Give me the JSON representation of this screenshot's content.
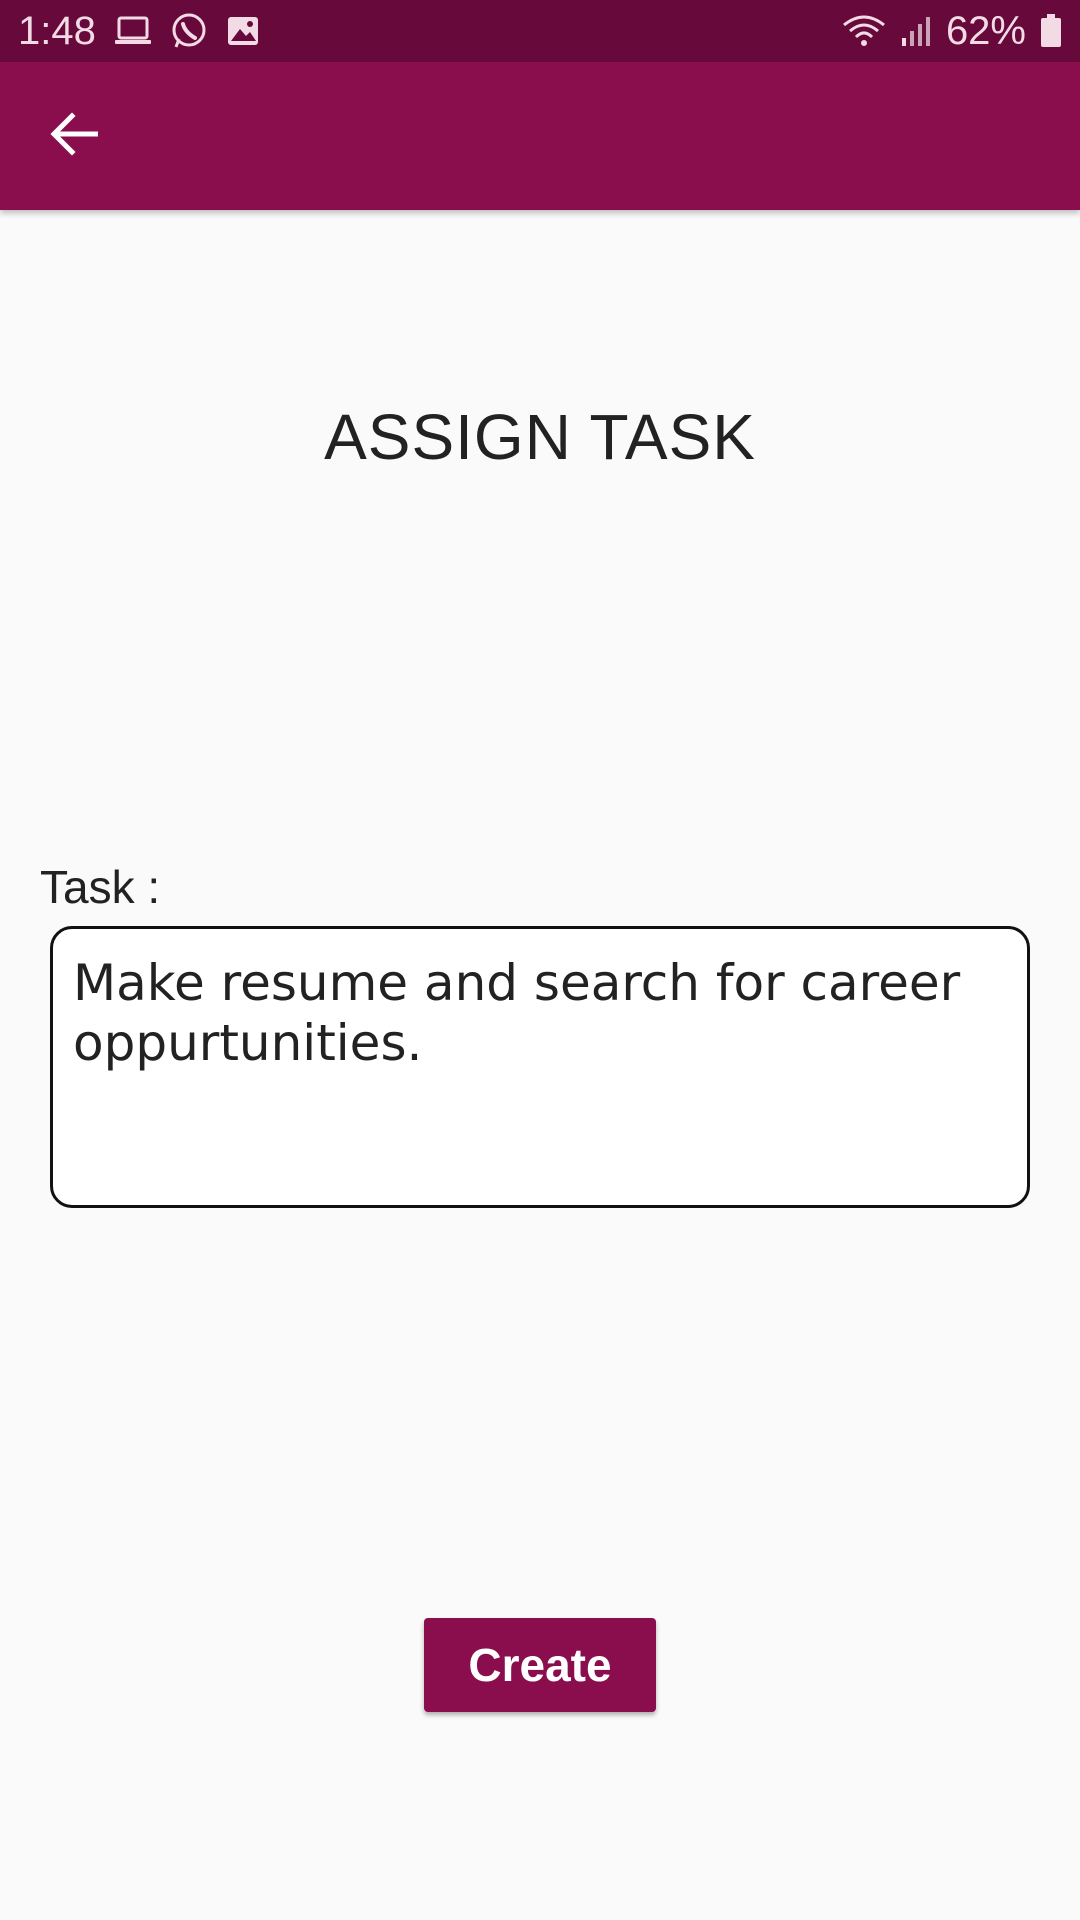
{
  "status_bar": {
    "time": "1:48",
    "battery": "62%",
    "left_icons": [
      "laptop-icon",
      "whatsapp-icon",
      "image-icon"
    ],
    "right_icons": [
      "wifi-icon",
      "signal-icon",
      "battery-icon"
    ]
  },
  "app_bar": {
    "back_icon": "arrow-left-icon"
  },
  "page": {
    "title": "ASSIGN TASK",
    "task_label": "Task :",
    "task_value": "Make resume and search for career oppurtunities.",
    "create_label": "Create"
  },
  "colors": {
    "status_bar": "#670a3b",
    "primary": "#8a0e4d",
    "background": "#fafafa"
  }
}
